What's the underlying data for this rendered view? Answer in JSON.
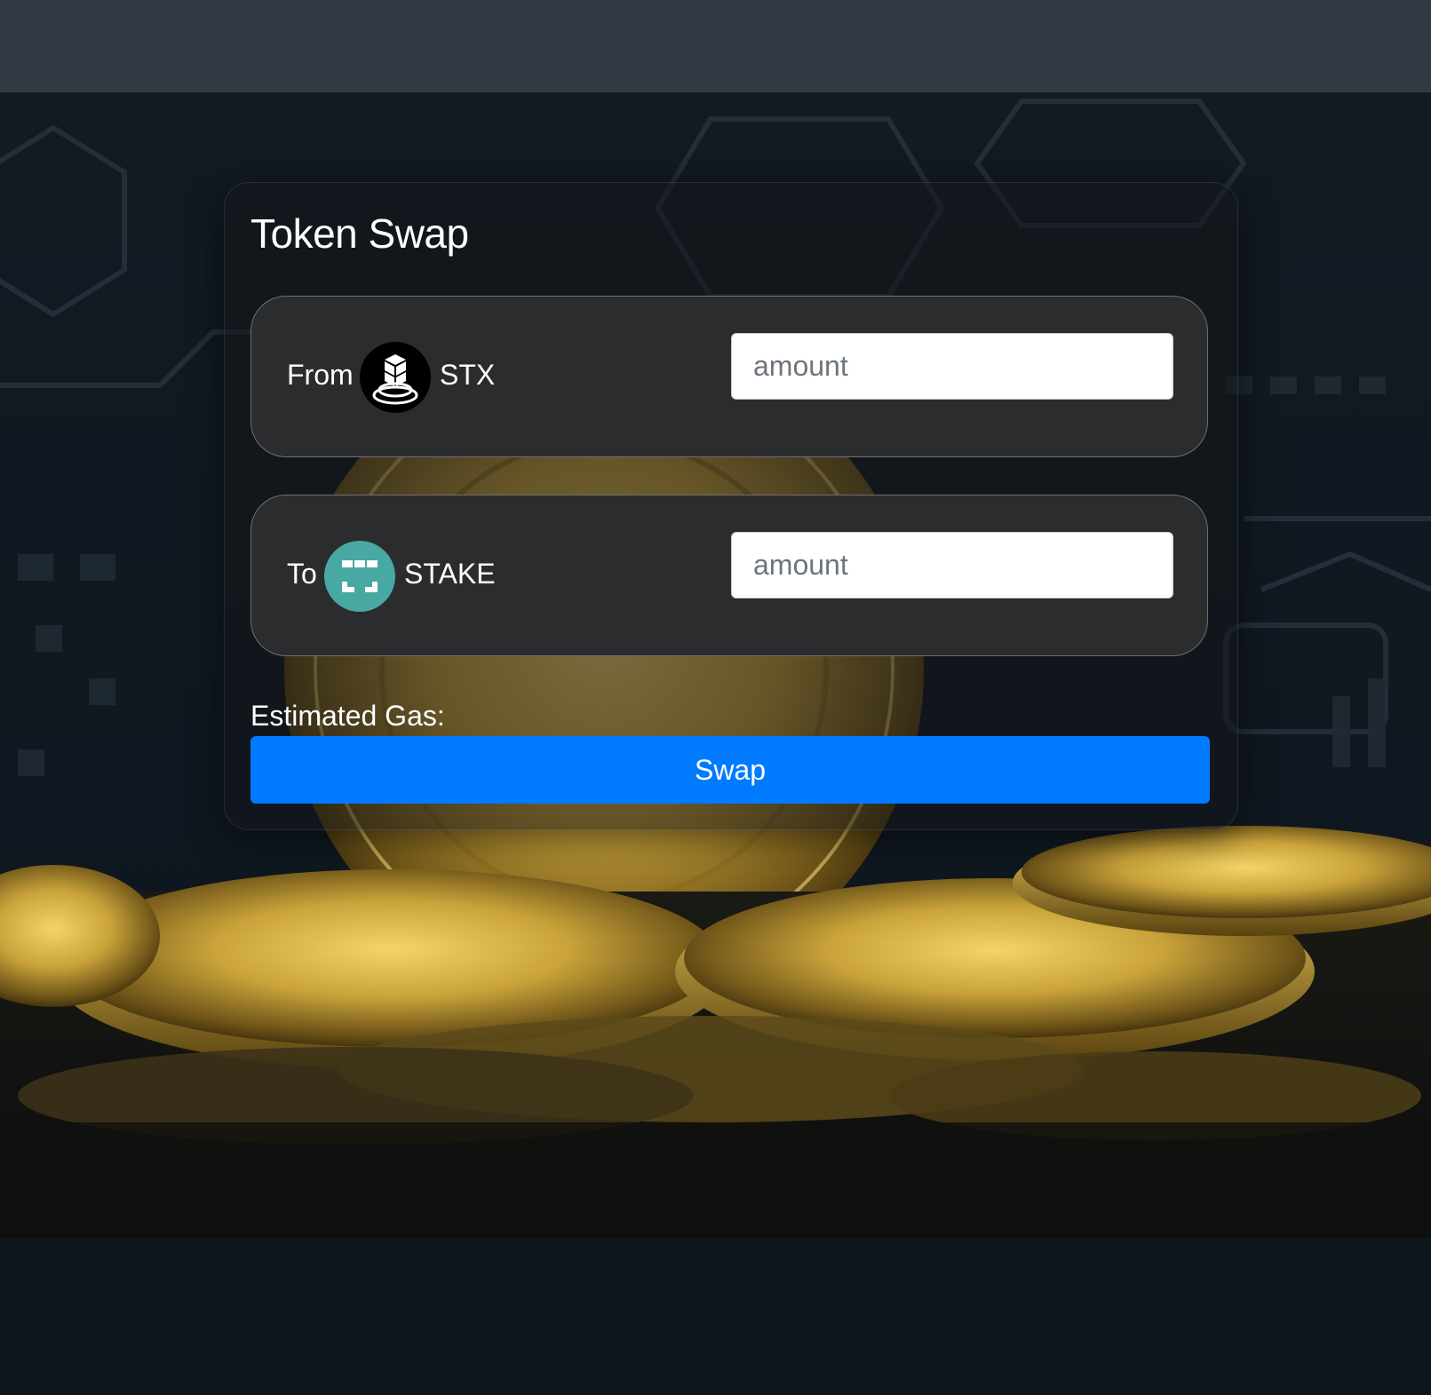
{
  "card": {
    "title": "Token Swap"
  },
  "from": {
    "label": "From",
    "token_symbol": "STX",
    "token_icon": "stx-token-icon",
    "amount_placeholder": "amount",
    "amount_value": ""
  },
  "to": {
    "label": "To",
    "token_symbol": "STAKE",
    "token_icon": "stake-token-icon",
    "amount_placeholder": "amount",
    "amount_value": ""
  },
  "gas": {
    "label": "Estimated Gas:"
  },
  "swap_button": {
    "label": "Swap"
  },
  "colors": {
    "topbar": "#343a43",
    "primary_button": "#007bff",
    "token_box": "#2b2c2e",
    "stake_token": "#48a8a2",
    "stx_token": "#000000",
    "coin_gold": "#c9a33a"
  }
}
